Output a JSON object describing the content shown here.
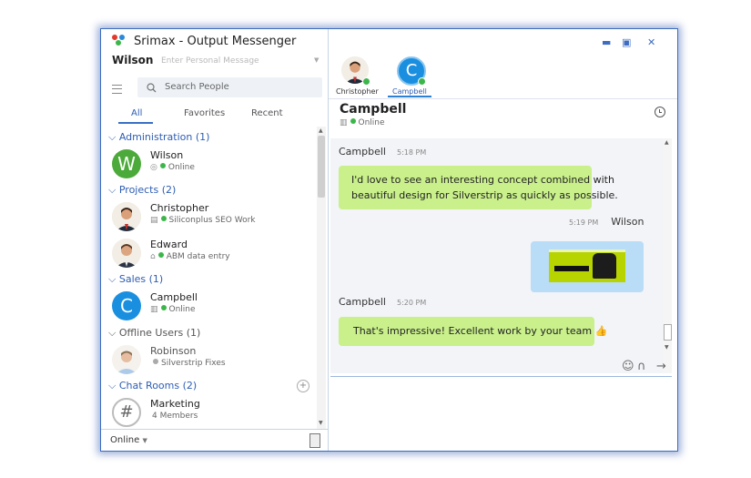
{
  "app": {
    "title": "Srimax - Output Messenger",
    "user_name": "Wilson",
    "personal_message_placeholder": "Enter Personal Message"
  },
  "search": {
    "placeholder": "Search People"
  },
  "filter_tabs": [
    {
      "label": "All",
      "active": true
    },
    {
      "label": "Favorites",
      "active": false
    },
    {
      "label": "Recent",
      "active": false
    }
  ],
  "groups": [
    {
      "label": "Administration (1)"
    },
    {
      "label": "Projects (2)"
    },
    {
      "label": "Sales (1)"
    },
    {
      "label": "Offline Users (1)"
    },
    {
      "label": "Chat Rooms (2)"
    }
  ],
  "contacts": [
    {
      "name": "Wilson",
      "status": "Online",
      "avatar_letter": "W",
      "avatar_color": "#4caa3a"
    },
    {
      "name": "Christopher",
      "status": "Siliconplus SEO Work"
    },
    {
      "name": "Edward",
      "status": "ABM data entry"
    },
    {
      "name": "Campbell",
      "status": "Online",
      "avatar_letter": "C",
      "avatar_color": "#1a8fe0"
    },
    {
      "name": "Robinson",
      "status": "Silverstrip Fixes"
    },
    {
      "name": "Marketing",
      "status": "4 Members",
      "avatar_letter": "#"
    }
  ],
  "presence": {
    "label": "Online"
  },
  "open_tabs": [
    {
      "label": "Christopher"
    },
    {
      "label": "Campbell",
      "active": true
    }
  ],
  "chat": {
    "name": "Campbell",
    "status": "Online",
    "messages": [
      {
        "sender": "Campbell",
        "time": "5:18 PM",
        "text_line1": "I'd love to see an interesting concept combined with",
        "text_line2": "beautiful design for Silverstrip as quickly as possible."
      },
      {
        "sender": "Wilson",
        "time": "5:19 PM",
        "type": "image"
      },
      {
        "sender": "Campbell",
        "time": "5:20 PM",
        "text": "That's impressive! Excellent work by your team"
      }
    ]
  },
  "colors": {
    "accent": "#2e5db3",
    "bubble_in": "#c9f08b",
    "bubble_out": "#b9dcf7",
    "online": "#3cb64a"
  }
}
